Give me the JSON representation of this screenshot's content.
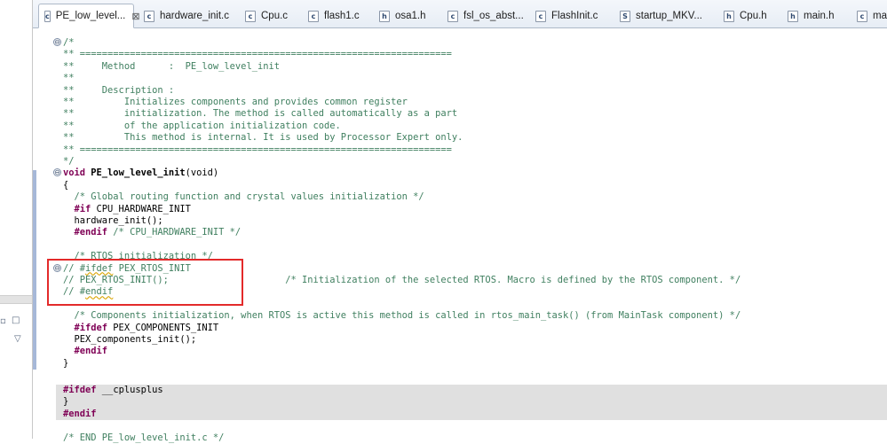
{
  "tabs": [
    {
      "label": "PE_low_level...",
      "icon": "c-file-icon",
      "icon_letter": "c",
      "active": true,
      "closable": true
    },
    {
      "label": "hardware_init.c",
      "icon": "c-file-icon",
      "icon_letter": "c"
    },
    {
      "label": "Cpu.c",
      "icon": "c-file-icon",
      "icon_letter": "c"
    },
    {
      "label": "flash1.c",
      "icon": "c-file-icon",
      "icon_letter": "c"
    },
    {
      "label": "osa1.h",
      "icon": "h-file-icon",
      "icon_letter": "h"
    },
    {
      "label": "fsl_os_abst...",
      "icon": "c-file-icon",
      "icon_letter": "c"
    },
    {
      "label": "FlashInit.c",
      "icon": "c-file-icon",
      "icon_letter": "c"
    },
    {
      "label": "startup_MKV...",
      "icon": "s-file-icon",
      "icon_letter": "S"
    },
    {
      "label": "Cpu.h",
      "icon": "h-file-icon",
      "icon_letter": "h"
    },
    {
      "label": "main.h",
      "icon": "h-file-icon",
      "icon_letter": "h"
    },
    {
      "label": "main",
      "icon": "c-file-icon",
      "icon_letter": "c"
    }
  ],
  "close_glyph": "⊠",
  "fold_glyph": "⊖",
  "code": {
    "l01": "/*",
    "l02": "** ===================================================================",
    "l03": "**     Method      :  PE_low_level_init",
    "l04": "**",
    "l05": "**     Description :",
    "l06": "**         Initializes components and provides common register",
    "l07": "**         initialization. The method is called automatically as a part",
    "l08": "**         of the application initialization code.",
    "l09": "**         This method is internal. It is used by Processor Expert only.",
    "l10": "** ===================================================================",
    "l11": "*/",
    "l12_kw": "void",
    "l12_fn": " PE_low_level_init",
    "l12_rest": "(void)",
    "l13": "{",
    "l14": "  /* Global routing function and crystal values initialization */",
    "l15_kw": "  #if",
    "l15_rest": " CPU_HARDWARE_INIT",
    "l16": "  hardware_init();",
    "l17_kw": "  #endif",
    "l17_cm": " /* CPU_HARDWARE_INIT */",
    "l18": "",
    "l19": "  /* RTOS initialization */",
    "l20_a": "// #",
    "l20_sq": "ifdef",
    "l20_b": " PEX_RTOS_INIT",
    "l21_a": "// PEX_RTOS_INIT();",
    "l21_b": "                     /* Initialization of the selected RTOS. Macro is defined by the RTOS component. */",
    "l22_a": "// #",
    "l22_sq": "endif",
    "l23": "",
    "l24": "  /* Components initialization, when RTOS is active this method is called in rtos_main_task() (from MainTask component) */",
    "l25_kw": "  #ifdef",
    "l25_rest": " PEX_COMPONENTS_INIT",
    "l26": "  PEX_components_init();",
    "l27_kw": "  #endif",
    "l28": "}",
    "l29": "",
    "l30_kw": "#ifdef",
    "l30_rest": " __cplusplus",
    "l31": "}",
    "l32_kw": "#endif",
    "l33": "",
    "l34": "/* END PE_low_level_init.c */"
  },
  "colors": {
    "keyword": "#7f0055",
    "comment": "#3f7f5f",
    "annotation_box": "#e32a2a",
    "highlight_bg": "#e0e0e0"
  }
}
